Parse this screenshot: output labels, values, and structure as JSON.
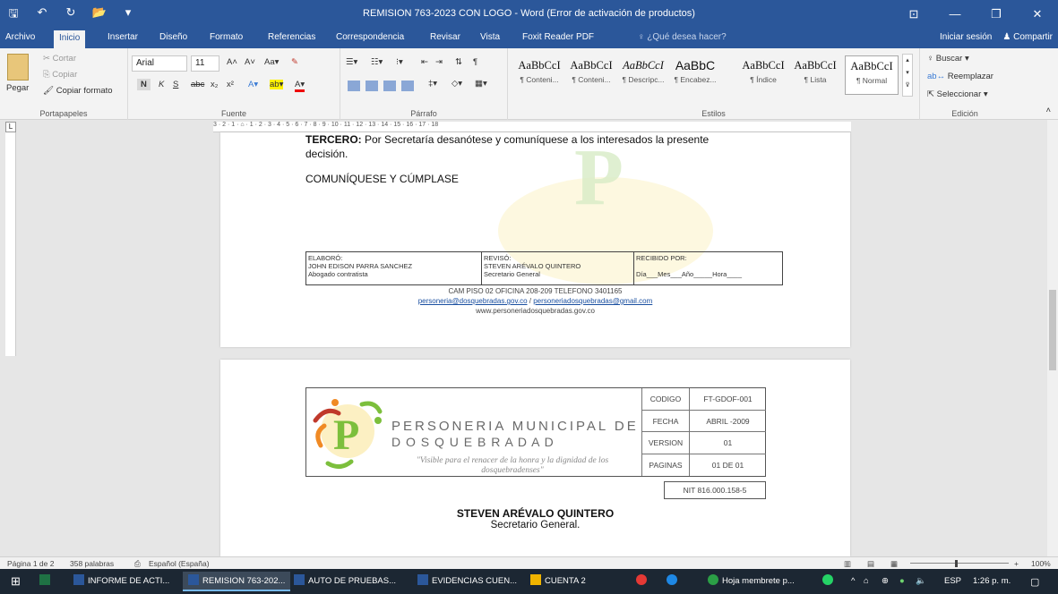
{
  "window": {
    "title": "REMISION 763-2023 CON LOGO - Word (Error de activación de productos)",
    "controls": {
      "ribbon_display": "⊡",
      "minimize": "—",
      "maximize": "❐",
      "close": "✕"
    }
  },
  "qat": {
    "save_icon": "🖫",
    "undo_icon": "↶",
    "redo_icon": "↻",
    "open_icon": "📂",
    "customize_icon": "▾"
  },
  "tabs": [
    {
      "label": "Archivo"
    },
    {
      "label": "Inicio"
    },
    {
      "label": "Insertar"
    },
    {
      "label": "Diseño"
    },
    {
      "label": "Formato"
    },
    {
      "label": "Referencias"
    },
    {
      "label": "Correspondencia"
    },
    {
      "label": "Revisar"
    },
    {
      "label": "Vista"
    },
    {
      "label": "Foxit Reader PDF"
    }
  ],
  "tellme": "♀ ¿Qué desea hacer?",
  "account": {
    "signin": "Iniciar sesión",
    "share": "♟ Compartir"
  },
  "ribbon": {
    "clipboard": {
      "paste": "Pegar",
      "cut": "Cortar",
      "copy": "Copiar",
      "format_painter": "Copiar formato",
      "label": "Portapapeles"
    },
    "font": {
      "name": "Arial",
      "size": "11",
      "grow": "A˄",
      "shrink": "A˅",
      "case": "Aa▾",
      "clear": "✎",
      "bold": "N",
      "italic": "K",
      "underline": "S",
      "strike": "abc",
      "subscript": "x₂",
      "superscript": "x²",
      "effects": "A▾",
      "highlight": "ab▾",
      "color": "A▾",
      "label": "Fuente"
    },
    "paragraph": {
      "bullets": "☰▾",
      "numbering": "☷▾",
      "multilevel": "⁝▾",
      "outdent": "⇤",
      "indent": "⇥",
      "sort": "⇅",
      "pilcrow": "¶",
      "label": "Párrafo"
    },
    "styles": [
      {
        "sample": "AaBbCcI",
        "name": "¶ Conteni..."
      },
      {
        "sample": "AaBbCcI",
        "name": "¶ Conteni..."
      },
      {
        "sample": "AaBbCcI",
        "name": "¶ Descripc..."
      },
      {
        "sample": "AaBbC",
        "name": "¶ Encabez..."
      },
      {
        "sample": "AaBbCcI",
        "name": "¶ Índice"
      },
      {
        "sample": "AaBbCcI",
        "name": "¶ Lista"
      },
      {
        "sample": "AaBbCcI",
        "name": "¶ Normal"
      }
    ],
    "styles_label": "Estilos",
    "editing": {
      "find": "♀ Buscar ▾",
      "replace": "Reemplazar",
      "select": "Seleccionar ▾",
      "label": "Edición"
    }
  },
  "ruler": {
    "scale": "3 · 2 · 1 · ⌂ · 1 · 2 · 3 · 4 · 5 · 6 · 7 · 8 · 9 · 10 · 11 · 12 · 13 · 14 · 15 · 16 · 17 · 18"
  },
  "page1": {
    "tercero_bold": "TERCERO:",
    "tercero_rest": " Por Secretaría desanótese y comuníquese a los interesados la presente",
    "tercero_line2": "decisión.",
    "closing": "COMUNÍQUESE Y CÚMPLASE",
    "signature": {
      "elaboro_label": "ELABORÓ:",
      "elaboro_name": "JOHN EDISON PARRA SANCHEZ",
      "elaboro_role": "Abogado contratista",
      "reviso_label": "REVISÓ:",
      "reviso_name": "STEVEN ARÉVALO QUINTERO",
      "reviso_role": "Secretario General",
      "recibido_label": "RECIBIDO POR:",
      "recibido_fields": "Día___Mes___Año_____Hora____"
    },
    "footer": {
      "address": "CAM PISO 02 OFICINA 208-209 TELEFONO 3401165",
      "email_1": "personeria@dosquebradas.gov.co",
      "separator": " / ",
      "email_2": "personeriadosquebradas@gmail.com",
      "website": "www.personeriadosquebradas.gov.co"
    }
  },
  "page2": {
    "org_line1": "PERSONERIA MUNICIPAL DE",
    "org_line2": "D O S Q U E B R A D A D",
    "slogan": "\"Visible para el renacer de la honra y la dignidad de los dosquebradenses\"",
    "codes": [
      {
        "key": "CODIGO",
        "value": "FT-GDOF-001"
      },
      {
        "key": "FECHA",
        "value": "ABRIL -2009"
      },
      {
        "key": "VERSION",
        "value": "01"
      },
      {
        "key": "PAGINAS",
        "value": "01 DE 01"
      }
    ],
    "nit": "NIT 816.000.158-5",
    "signer_name": "STEVEN ARÉVALO QUINTERO",
    "signer_role": "Secretario General."
  },
  "statusbar": {
    "page": "Página 1 de 2",
    "words": "358 palabras",
    "language": "Español (España)",
    "zoom": "100%"
  },
  "taskbar": {
    "items": [
      {
        "label": "INFORME DE ACTI..."
      },
      {
        "label": "REMISION 763-202..."
      },
      {
        "label": "AUTO DE PRUEBAS..."
      },
      {
        "label": "EVIDENCIAS CUEN..."
      },
      {
        "label": "CUENTA 2"
      },
      {
        "label": "Hoja membrete p..."
      }
    ],
    "lang": "ESP",
    "time": "1:26 p. m."
  },
  "colors": {
    "word_blue": "#2b579a",
    "logo_green": "#7cbf3c",
    "logo_orange": "#f08a24",
    "logo_red": "#c0392b"
  }
}
